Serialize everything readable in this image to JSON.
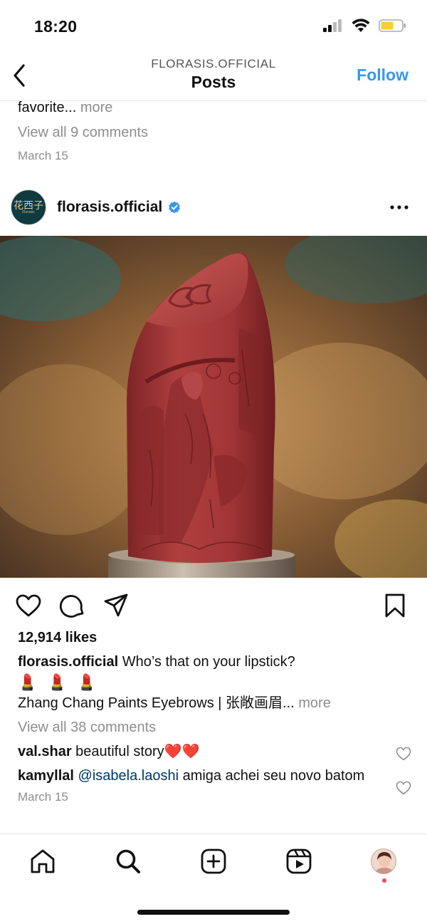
{
  "status": {
    "time": "18:20"
  },
  "header": {
    "subtitle": "FLORASIS.OFFICIAL",
    "title": "Posts",
    "follow_label": "Follow"
  },
  "previous_post": {
    "caption_tail": "favorite...",
    "more_label": "more",
    "view_comments": "View all 9 comments",
    "date": "March 15"
  },
  "post": {
    "avatar_glyph": "花西子",
    "avatar_text": "Florasis",
    "username": "florasis.official",
    "verified_icon": "verified-badge-icon",
    "likes": "12,914 likes",
    "caption_user": "florasis.official",
    "caption_text": "Who’s that on your lipstick?",
    "caption_emoji": "💄 💄 💄",
    "caption_line2": "Zhang Chang Paints Eyebrows | 张敞画眉...",
    "more_label": "more",
    "view_comments": "View all 38 comments",
    "comments": [
      {
        "user": "val.shar",
        "text": "beautiful story",
        "emoji": "❤️❤️"
      },
      {
        "user": "kamyllal",
        "mention": "@isabela.laoshi",
        "text": "amiga achei seu novo batom"
      }
    ],
    "date": "March 15"
  },
  "colors": {
    "accent": "#3897f0",
    "lipstick": "#a93a3c",
    "notification": "#ed4956"
  },
  "tabs": [
    "home-icon",
    "search-icon",
    "new-post-icon",
    "reels-icon",
    "profile-avatar"
  ]
}
